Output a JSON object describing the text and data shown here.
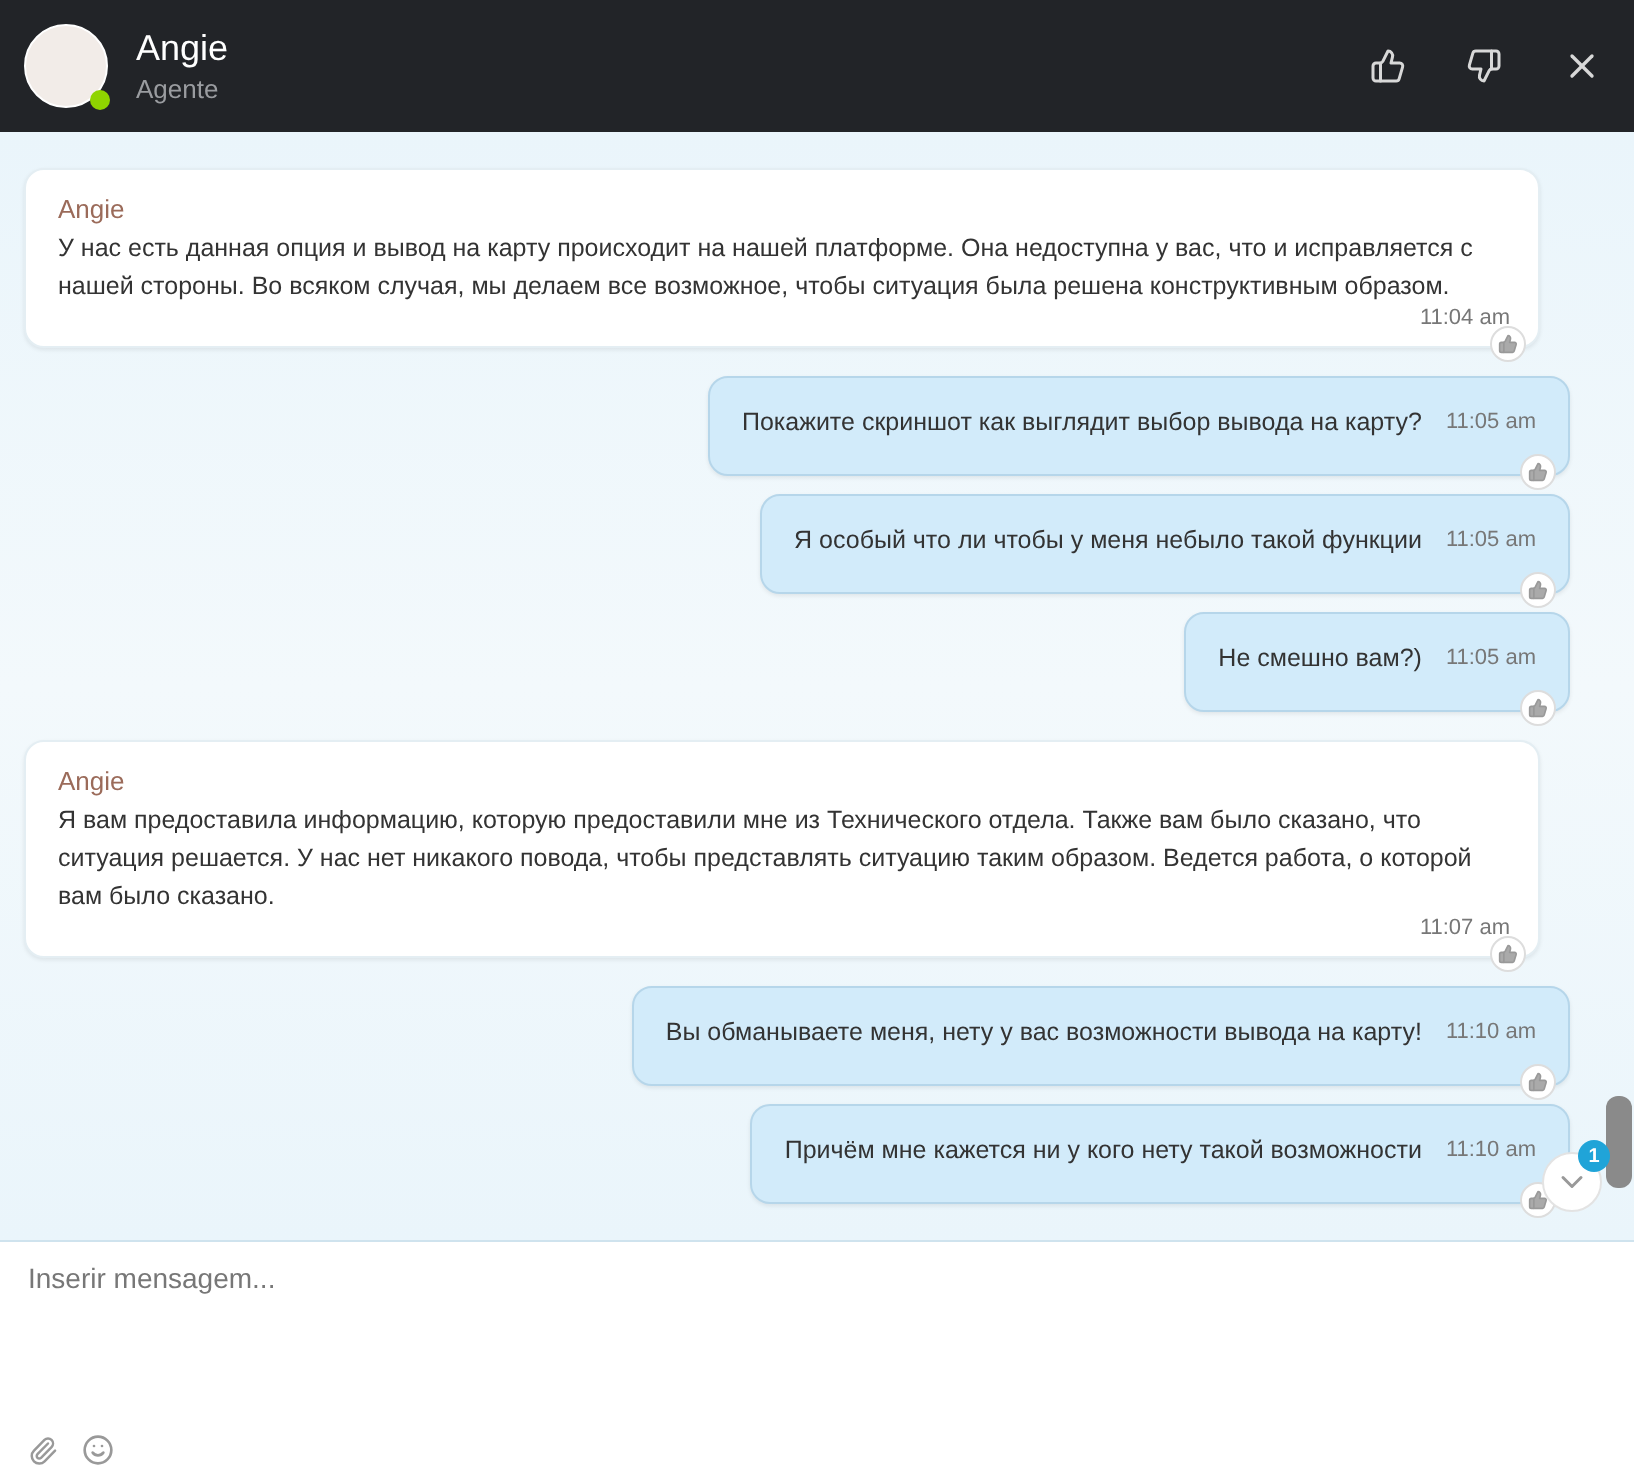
{
  "header": {
    "name": "Angie",
    "role": "Agente",
    "online": true
  },
  "messages": [
    {
      "kind": "agent",
      "sender": "Angie",
      "text": "У нас есть данная опция и вывод на карту происходит на нашей платформе. Она недоступна у вас, что и исправляется с нашей стороны. Во всяком случая, мы делаем все возможное, чтобы ситуация была решена конструктивным образом.",
      "time": "11:04 am"
    },
    {
      "kind": "user",
      "text": "Покажите скриншот как выглядит выбор вывода на карту?",
      "time": "11:05 am"
    },
    {
      "kind": "user",
      "text": "Я особый что ли чтобы у меня небыло такой функции",
      "time": "11:05 am"
    },
    {
      "kind": "user",
      "text": "Не смешно вам?)",
      "time": "11:05 am"
    },
    {
      "kind": "agent",
      "sender": "Angie",
      "text": "Я вам предоставила информацию, которую предоставили мне из Технического отдела. Также вам было сказано, что ситуация решается. У  нас нет никакого повода, чтобы представлять ситуацию таким образом. Ведется работа, о которой вам было сказано.",
      "time": "11:07 am"
    },
    {
      "kind": "user",
      "text": "Вы обманываете меня, нету у вас возможности вывода на карту!",
      "time": "11:10 am"
    },
    {
      "kind": "user",
      "text": "Причём мне кажется ни у кого нету такой возможности",
      "time": "11:10 am"
    }
  ],
  "unread_count": "1",
  "composer": {
    "placeholder": "Inserir mensagem..."
  }
}
